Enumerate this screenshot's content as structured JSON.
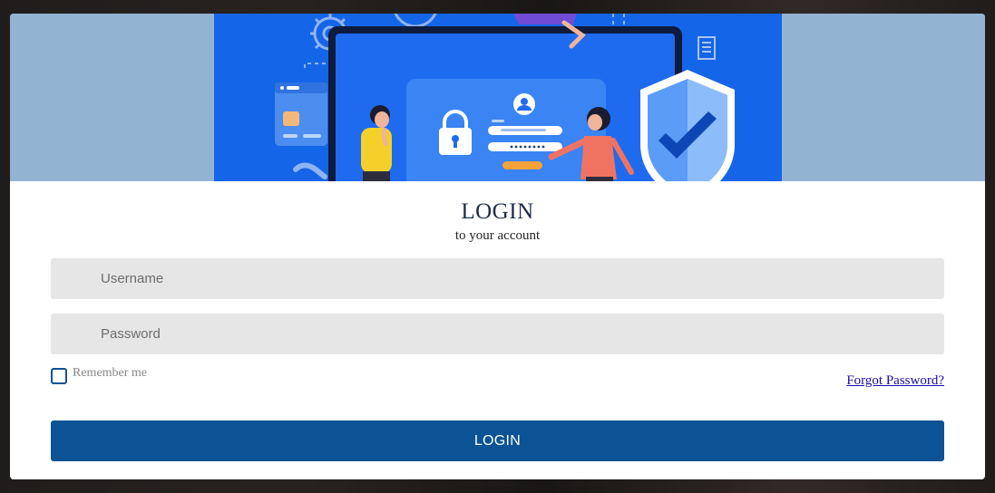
{
  "colors": {
    "banner_bg": "#93b3d3",
    "art_bg": "#1565e8",
    "field_bg": "#e6e6e6",
    "accent": "#0b5394",
    "link": "#1a0dab"
  },
  "banner": {
    "illustration": "login-security-illustration",
    "icons": [
      "gear-icon",
      "credit-card-icon",
      "document-icon",
      "laptop-icon",
      "padlock-icon",
      "user-icon",
      "shield-check-icon"
    ]
  },
  "login": {
    "title": "LOGIN",
    "subtitle": "to your account",
    "username_placeholder": "Username",
    "password_placeholder": "Password",
    "remember_label": "Remember me",
    "forgot_link": "Forgot Password?",
    "submit_label": "LOGIN"
  }
}
